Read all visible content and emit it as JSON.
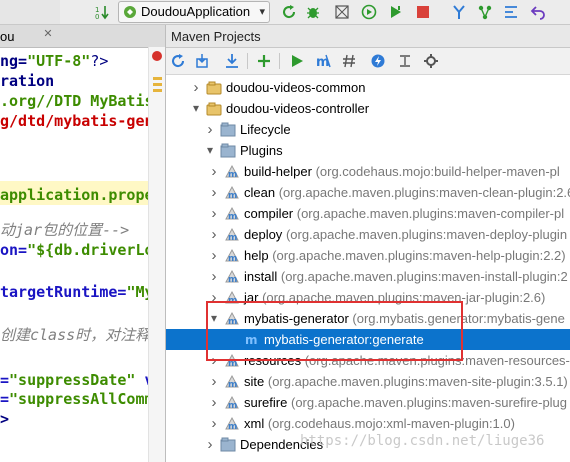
{
  "toolbar": {
    "run_config": "DoudouApplication",
    "run_config_chevron": "▾",
    "icons": [
      "sort-down-icon",
      "build-icon",
      "run-config-icon",
      "reload-icon",
      "debug-icon",
      "coverage-icon",
      "profile-icon",
      "run-icon",
      "stop-icon",
      "vcs-update-icon",
      "vcs-branch-icon",
      "vcs-commit-icon",
      "undo-icon"
    ]
  },
  "editor": {
    "tab_label": "ou",
    "lines": [
      {
        "parts": [
          {
            "t": "ng=",
            "c": "navy bold"
          },
          {
            "t": "\"UTF-8\"",
            "c": "green bold"
          },
          {
            "t": "?>",
            "c": "navy"
          }
        ]
      },
      {
        "parts": [
          {
            "t": "ration",
            "c": "navy bold"
          }
        ]
      },
      {
        "parts": [
          {
            "t": ".org//DTD MyBatis",
            "c": "green bold"
          }
        ]
      },
      {
        "parts": [
          {
            "t": "g/dtd/mybatis-gen",
            "c": "red bold"
          }
        ]
      },
      {
        "parts": []
      },
      {
        "parts": []
      },
      {
        "parts": [
          {
            "t": "application.prope",
            "c": "green bold"
          }
        ]
      },
      {
        "parts": []
      },
      {
        "parts": [
          {
            "t": "动jar包的位置-->",
            "c": "grey"
          }
        ]
      },
      {
        "parts": [
          {
            "t": "on=",
            "c": "blue bold"
          },
          {
            "t": "\"${db.driverLo",
            "c": "green bold"
          }
        ]
      },
      {
        "parts": []
      },
      {
        "parts": [
          {
            "t": "targetRuntime=",
            "c": "blue bold"
          },
          {
            "t": "\"My",
            "c": "green bold"
          }
        ]
      },
      {
        "parts": []
      },
      {
        "parts": [
          {
            "t": "创建class时，对注释进",
            "c": "grey"
          }
        ]
      },
      {
        "parts": []
      },
      {
        "parts": [
          {
            "t": "=",
            "c": "blue bold"
          },
          {
            "t": "\"suppressDate\"",
            "c": "green bold"
          },
          {
            "t": " v",
            "c": "blue bold"
          }
        ]
      },
      {
        "parts": [
          {
            "t": "=",
            "c": "blue bold"
          },
          {
            "t": "\"suppressAllComm",
            "c": "green bold"
          }
        ]
      },
      {
        "parts": [
          {
            "t": ">",
            "c": "navy bold"
          }
        ]
      },
      {
        "parts": []
      },
      {
        "parts": [
          {
            "t": "-->",
            "c": "grey"
          }
        ]
      }
    ]
  },
  "maven": {
    "title": "Maven Projects",
    "tool_icons": [
      "refresh-icon",
      "reimport-icon",
      "download-icon",
      "add-icon",
      "run-maven-icon",
      "execute-goal-icon",
      "toggle-offline-icon",
      "skip-tests-icon",
      "collapse-icon",
      "settings-icon"
    ],
    "tree": [
      {
        "indent": 0,
        "arrow": "›",
        "icon": "module",
        "label": "doudou-videos-common",
        "suffix": ""
      },
      {
        "indent": 0,
        "arrow": "⌄",
        "icon": "module",
        "label": "doudou-videos-controller",
        "suffix": ""
      },
      {
        "indent": 1,
        "arrow": "›",
        "icon": "folder",
        "label": "Lifecycle",
        "suffix": ""
      },
      {
        "indent": 1,
        "arrow": "⌄",
        "icon": "folder",
        "label": "Plugins",
        "suffix": ""
      },
      {
        "indent": 2,
        "arrow": "›",
        "icon": "plugin",
        "label": "build-helper",
        "suffix": "(org.codehaus.mojo:build-helper-maven-pl"
      },
      {
        "indent": 2,
        "arrow": "›",
        "icon": "plugin",
        "label": "clean",
        "suffix": "(org.apache.maven.plugins:maven-clean-plugin:2.6"
      },
      {
        "indent": 2,
        "arrow": "›",
        "icon": "plugin",
        "label": "compiler",
        "suffix": "(org.apache.maven.plugins:maven-compiler-pl"
      },
      {
        "indent": 2,
        "arrow": "›",
        "icon": "plugin",
        "label": "deploy",
        "suffix": "(org.apache.maven.plugins:maven-deploy-plugin"
      },
      {
        "indent": 2,
        "arrow": "›",
        "icon": "plugin",
        "label": "help",
        "suffix": "(org.apache.maven.plugins:maven-help-plugin:2.2)"
      },
      {
        "indent": 2,
        "arrow": "›",
        "icon": "plugin",
        "label": "install",
        "suffix": "(org.apache.maven.plugins:maven-install-plugin:2"
      },
      {
        "indent": 2,
        "arrow": "›",
        "icon": "plugin",
        "label": "jar",
        "suffix": "(org.apache.maven.plugins:maven-jar-plugin:2.6)"
      },
      {
        "indent": 2,
        "arrow": "⌄",
        "icon": "plugin",
        "label": "mybatis-generator",
        "suffix": "(org.mybatis.generator:mybatis-gene"
      },
      {
        "indent": 3,
        "arrow": "",
        "icon": "goal",
        "label": "mybatis-generator:generate",
        "suffix": "",
        "selected": true
      },
      {
        "indent": 2,
        "arrow": "›",
        "icon": "plugin",
        "label": "resources",
        "suffix": "(org.apache.maven.plugins:maven-resources-"
      },
      {
        "indent": 2,
        "arrow": "›",
        "icon": "plugin",
        "label": "site",
        "suffix": "(org.apache.maven.plugins:maven-site-plugin:3.5.1)"
      },
      {
        "indent": 2,
        "arrow": "›",
        "icon": "plugin",
        "label": "surefire",
        "suffix": "(org.apache.maven.plugins:maven-surefire-plug"
      },
      {
        "indent": 2,
        "arrow": "›",
        "icon": "plugin",
        "label": "xml",
        "suffix": "(org.codehaus.mojo:xml-maven-plugin:1.0)"
      },
      {
        "indent": 1,
        "arrow": "›",
        "icon": "folder",
        "label": "Dependencies",
        "suffix": ""
      }
    ]
  },
  "watermark": "https://blog.csdn.net/liuge36",
  "colors": {
    "selection": "#0c73cc",
    "highlight_box": "#e03131",
    "maven_icon": "#3a7dc9"
  }
}
